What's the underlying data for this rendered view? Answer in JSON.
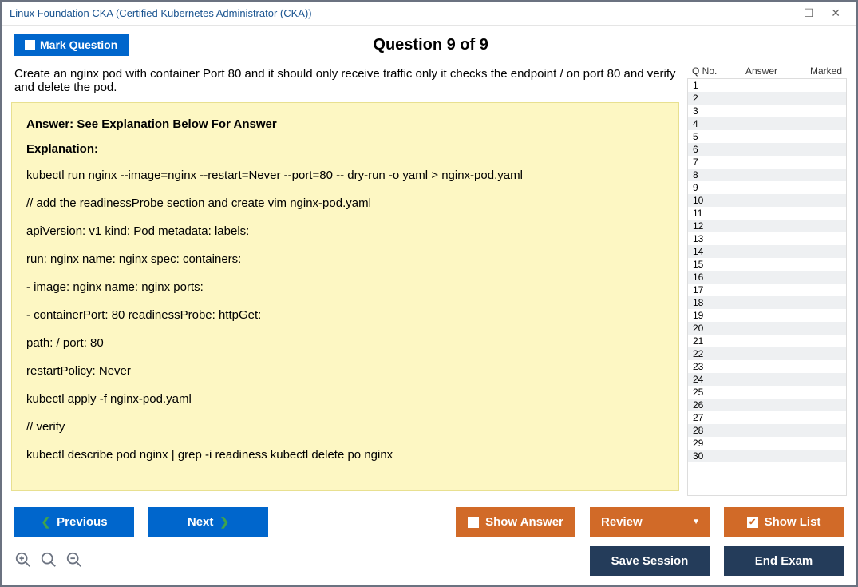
{
  "titlebar": {
    "text": "Linux Foundation CKA (Certified Kubernetes Administrator (CKA))"
  },
  "topbar": {
    "mark_label": "Mark Question",
    "title": "Question 9 of 9"
  },
  "question": {
    "text": "Create an nginx pod with container Port 80 and it should only receive traffic only it checks the endpoint / on port 80 and verify and delete the pod."
  },
  "answer": {
    "header": "Answer: See Explanation Below For Answer",
    "exp_header": "Explanation:",
    "lines": [
      "kubectl run nginx --image=nginx --restart=Never --port=80 -- dry-run -o yaml > nginx-pod.yaml",
      "// add the readinessProbe section and create vim nginx-pod.yaml",
      "apiVersion: v1 kind: Pod metadata: labels:",
      "run: nginx name: nginx spec: containers:",
      "- image: nginx name: nginx ports:",
      "- containerPort: 80 readinessProbe: httpGet:",
      "path: / port: 80",
      "restartPolicy: Never",
      "kubectl apply -f nginx-pod.yaml",
      "// verify",
      "kubectl describe pod nginx | grep -i readiness kubectl delete po nginx"
    ]
  },
  "qlist": {
    "headers": {
      "qno": "Q No.",
      "answer": "Answer",
      "marked": "Marked"
    },
    "rows": [
      "1",
      "2",
      "3",
      "4",
      "5",
      "6",
      "7",
      "8",
      "9",
      "10",
      "11",
      "12",
      "13",
      "14",
      "15",
      "16",
      "17",
      "18",
      "19",
      "20",
      "21",
      "22",
      "23",
      "24",
      "25",
      "26",
      "27",
      "28",
      "29",
      "30"
    ]
  },
  "buttons": {
    "previous": "Previous",
    "next": "Next",
    "show_answer": "Show Answer",
    "review": "Review",
    "show_list": "Show List",
    "save_session": "Save Session",
    "end_exam": "End Exam"
  }
}
